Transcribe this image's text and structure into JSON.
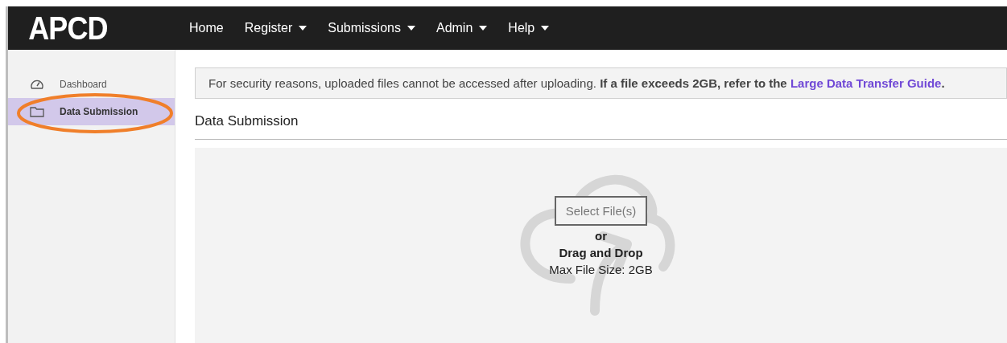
{
  "brand": "APCD",
  "nav": [
    {
      "label": "Home",
      "dropdown": false
    },
    {
      "label": "Register",
      "dropdown": true
    },
    {
      "label": "Submissions",
      "dropdown": true
    },
    {
      "label": "Admin",
      "dropdown": true
    },
    {
      "label": "Help",
      "dropdown": true
    }
  ],
  "sidebar": {
    "items": [
      {
        "label": "Dashboard",
        "selected": false
      },
      {
        "label": "Data Submission",
        "selected": true
      }
    ]
  },
  "notice": {
    "text": "For security reasons, uploaded files cannot be accessed after uploading. **If a file exceeds 2GB, refer to the**",
    "link": "Large Data Transfer Guide",
    "end": "**.**"
  },
  "section_title": "Data Submission",
  "upload": {
    "button": "Select File(s)",
    "or": "or",
    "drag": "Drag and Drop",
    "max_size": "Max File Size: 2GB"
  }
}
